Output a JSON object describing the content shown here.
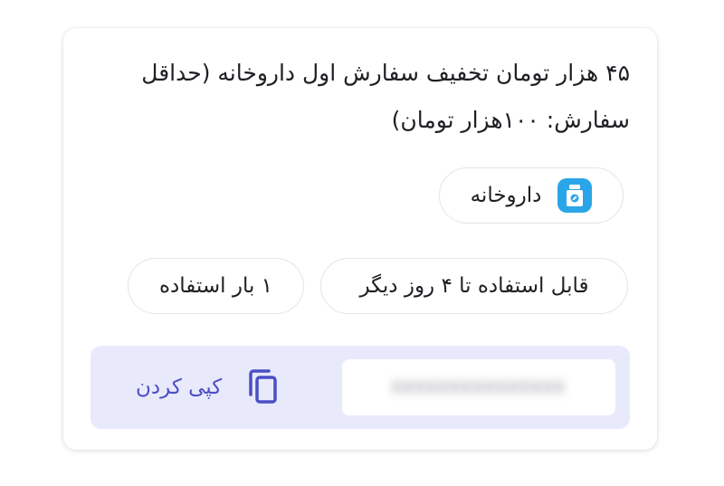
{
  "coupon": {
    "title": "۴۵ هزار تومان تخفیف سفارش اول داروخانه (حداقل سفارش: ۱۰۰هزار تومان)",
    "category": {
      "label": "داروخانه",
      "icon": "medicine-bottle-icon",
      "icon_color": "#2aa6e8"
    },
    "validity": "قابل استفاده تا ۴ روز دیگر",
    "usage": "۱ بار استفاده",
    "code": {
      "value": "XXXXXXXXXXXXXXX",
      "copy_label": "کپی کردن",
      "copy_icon": "copy-icon",
      "accent_color": "#4b4fc4",
      "bar_color": "#e8e9fb"
    }
  }
}
